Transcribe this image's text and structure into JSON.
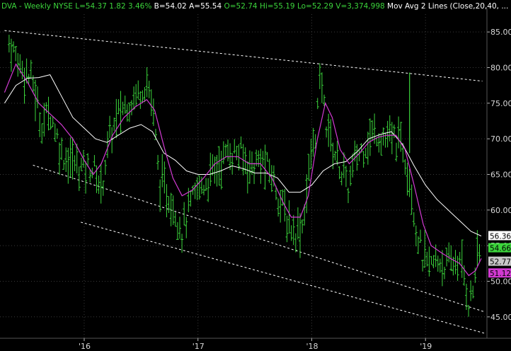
{
  "header": {
    "symbol": "DVA",
    "parts": [
      {
        "text": "DVA - Weekly  NYSE",
        "color": "#3bd43b"
      },
      {
        "text": "L=54.37",
        "color": "#3bd43b"
      },
      {
        "text": "1.82",
        "color": "#3bd43b"
      },
      {
        "text": "3.46%",
        "color": "#3bd43b"
      },
      {
        "text": "B=54.02",
        "color": "#ffffff"
      },
      {
        "text": "A=55.54",
        "color": "#ffffff"
      },
      {
        "text": "O=52.74",
        "color": "#3bd43b"
      },
      {
        "text": "Hi=55.19",
        "color": "#3bd43b"
      },
      {
        "text": "Lo=52.29",
        "color": "#3bd43b"
      },
      {
        "text": "V=3,374,998",
        "color": "#3bd43b"
      },
      {
        "text": "Mov Avg 2 Lines (Close,20,40,",
        "color": "#ffffff"
      },
      {
        "text": "...",
        "color": "#ffffff"
      }
    ]
  },
  "colors": {
    "background": "#000000",
    "bars": "#3bd43b",
    "ma_fast": "#d23ad2",
    "ma_slow": "#ffffff",
    "trendlines": "#ffffff",
    "grid": "#3a3a3a"
  },
  "chart_data": {
    "type": "line",
    "ylim": [
      42,
      87.5
    ],
    "y_ticks": [
      "45.00",
      "50.00",
      "55.00",
      "60.00",
      "65.00",
      "70.00",
      "75.00",
      "80.00",
      "85.00"
    ],
    "x_ticks": [
      "'16",
      "'17",
      "'18",
      "'19"
    ],
    "grid": true,
    "series": [],
    "price_tags": [
      {
        "label": "56.36",
        "value": 56.36,
        "bg": "#ffffff",
        "fg": "#000000"
      },
      {
        "label": "54.66",
        "value": 54.66,
        "bg": "#3bd43b",
        "fg": "#000000"
      },
      {
        "label": "52.77",
        "value": 52.77,
        "bg": "#c8c8c8",
        "fg": "#000000"
      },
      {
        "label": "51.12",
        "value": 51.12,
        "bg": "#d23ad2",
        "fg": "#000000"
      }
    ],
    "price_path": [
      [
        2015.34,
        83.5
      ],
      [
        2015.45,
        80
      ],
      [
        2015.55,
        78
      ],
      [
        2015.62,
        72
      ],
      [
        2015.7,
        74
      ],
      [
        2015.8,
        68
      ],
      [
        2015.88,
        67
      ],
      [
        2015.97,
        66
      ],
      [
        2016.08,
        66
      ],
      [
        2016.15,
        63
      ],
      [
        2016.22,
        70
      ],
      [
        2016.32,
        74
      ],
      [
        2016.45,
        76
      ],
      [
        2016.55,
        78
      ],
      [
        2016.6,
        75
      ],
      [
        2016.66,
        64
      ],
      [
        2016.74,
        62
      ],
      [
        2016.8,
        60
      ],
      [
        2016.86,
        57
      ],
      [
        2016.92,
        60
      ],
      [
        2017.0,
        63
      ],
      [
        2017.08,
        64
      ],
      [
        2017.16,
        66
      ],
      [
        2017.26,
        68
      ],
      [
        2017.36,
        68
      ],
      [
        2017.46,
        66
      ],
      [
        2017.56,
        67
      ],
      [
        2017.65,
        65
      ],
      [
        2017.73,
        61
      ],
      [
        2017.8,
        58
      ],
      [
        2017.86,
        57
      ],
      [
        2017.92,
        58
      ],
      [
        2017.98,
        66
      ],
      [
        2018.04,
        72
      ],
      [
        2018.08,
        79
      ],
      [
        2018.12,
        73
      ],
      [
        2018.18,
        69
      ],
      [
        2018.25,
        66
      ],
      [
        2018.32,
        63
      ],
      [
        2018.38,
        67
      ],
      [
        2018.46,
        69
      ],
      [
        2018.56,
        71
      ],
      [
        2018.64,
        70
      ],
      [
        2018.72,
        70
      ],
      [
        2018.8,
        69
      ],
      [
        2018.86,
        65
      ],
      [
        2018.92,
        57
      ],
      [
        2018.98,
        53
      ],
      [
        2019.04,
        52
      ],
      [
        2019.12,
        53
      ],
      [
        2019.2,
        52
      ],
      [
        2019.28,
        53
      ],
      [
        2019.34,
        51
      ],
      [
        2019.38,
        47
      ],
      [
        2019.41,
        48
      ],
      [
        2019.45,
        53
      ],
      [
        2019.49,
        54.37
      ]
    ],
    "ma_fast_path": [
      [
        2015.3,
        76.5
      ],
      [
        2015.4,
        80.5
      ],
      [
        2015.5,
        78
      ],
      [
        2015.6,
        75
      ],
      [
        2015.7,
        73.5
      ],
      [
        2015.8,
        72
      ],
      [
        2015.9,
        70
      ],
      [
        2016.0,
        67
      ],
      [
        2016.08,
        65
      ],
      [
        2016.15,
        66.5
      ],
      [
        2016.25,
        70.5
      ],
      [
        2016.35,
        73
      ],
      [
        2016.45,
        74.5
      ],
      [
        2016.55,
        75.5
      ],
      [
        2016.62,
        74
      ],
      [
        2016.7,
        69
      ],
      [
        2016.78,
        64.5
      ],
      [
        2016.86,
        62
      ],
      [
        2016.95,
        62.8
      ],
      [
        2017.05,
        64.5
      ],
      [
        2017.15,
        66.5
      ],
      [
        2017.25,
        67.5
      ],
      [
        2017.35,
        67.5
      ],
      [
        2017.45,
        66.5
      ],
      [
        2017.55,
        66.5
      ],
      [
        2017.65,
        64.5
      ],
      [
        2017.75,
        61
      ],
      [
        2017.82,
        59
      ],
      [
        2017.9,
        59
      ],
      [
        2017.97,
        62
      ],
      [
        2018.05,
        70
      ],
      [
        2018.12,
        75
      ],
      [
        2018.18,
        73
      ],
      [
        2018.25,
        68.5
      ],
      [
        2018.33,
        66.5
      ],
      [
        2018.42,
        68
      ],
      [
        2018.5,
        69.5
      ],
      [
        2018.58,
        70.2
      ],
      [
        2018.66,
        70.5
      ],
      [
        2018.74,
        70.5
      ],
      [
        2018.82,
        68.5
      ],
      [
        2018.9,
        63.5
      ],
      [
        2018.98,
        58
      ],
      [
        2019.05,
        55
      ],
      [
        2019.14,
        54
      ],
      [
        2019.22,
        53.2
      ],
      [
        2019.3,
        52.5
      ],
      [
        2019.38,
        50.8
      ],
      [
        2019.44,
        51.5
      ],
      [
        2019.49,
        53.2
      ]
    ],
    "ma_slow_path": [
      [
        2015.3,
        75
      ],
      [
        2015.4,
        77.5
      ],
      [
        2015.5,
        78.5
      ],
      [
        2015.6,
        78.6
      ],
      [
        2015.7,
        79
      ],
      [
        2015.8,
        76
      ],
      [
        2015.9,
        73
      ],
      [
        2016.0,
        71.5
      ],
      [
        2016.1,
        70
      ],
      [
        2016.2,
        69.5
      ],
      [
        2016.3,
        70.5
      ],
      [
        2016.4,
        71.5
      ],
      [
        2016.5,
        72
      ],
      [
        2016.6,
        71
      ],
      [
        2016.7,
        68
      ],
      [
        2016.8,
        67
      ],
      [
        2016.9,
        65.5
      ],
      [
        2017.0,
        65
      ],
      [
        2017.1,
        65
      ],
      [
        2017.2,
        65.5
      ],
      [
        2017.3,
        66.2
      ],
      [
        2017.4,
        65.8
      ],
      [
        2017.5,
        65.2
      ],
      [
        2017.6,
        65.2
      ],
      [
        2017.7,
        64.5
      ],
      [
        2017.8,
        62.5
      ],
      [
        2017.9,
        62.5
      ],
      [
        2018.0,
        63.5
      ],
      [
        2018.1,
        65.5
      ],
      [
        2018.2,
        66.5
      ],
      [
        2018.3,
        66.8
      ],
      [
        2018.4,
        68.2
      ],
      [
        2018.5,
        70
      ],
      [
        2018.6,
        70.6
      ],
      [
        2018.7,
        71
      ],
      [
        2018.8,
        69.2
      ],
      [
        2018.9,
        66.2
      ],
      [
        2019.0,
        63.5
      ],
      [
        2019.1,
        61.5
      ],
      [
        2019.2,
        60
      ],
      [
        2019.3,
        58.5
      ],
      [
        2019.4,
        57
      ],
      [
        2019.49,
        56.36
      ]
    ],
    "spikes": [
      {
        "x": 2018.86,
        "low": 68,
        "high": 79.3
      }
    ],
    "trendlines": [
      {
        "from": [
          2015.3,
          85.2
        ],
        "to": [
          2019.5,
          78.1
        ]
      },
      {
        "from": [
          2015.55,
          66.3
        ],
        "to": [
          2019.52,
          45.7
        ]
      },
      {
        "from": [
          2015.97,
          58.3
        ],
        "to": [
          2019.52,
          42.7
        ]
      }
    ],
    "x_range": [
      2015.26,
      2019.54
    ]
  }
}
